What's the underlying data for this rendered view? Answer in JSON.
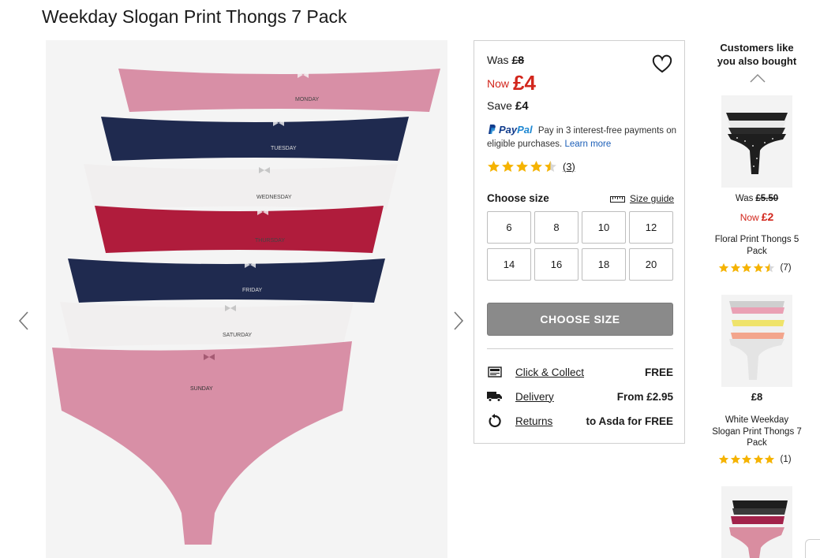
{
  "product": {
    "title": "Weekday Slogan Print Thongs 7 Pack"
  },
  "gallery": {
    "prev_icon": "chevron-left-icon",
    "next_icon": "chevron-right-icon",
    "image_colors": [
      "#d88fa6",
      "#1f2a4f",
      "#f1efef",
      "#b01c3c",
      "#1f2a4f",
      "#f1efef",
      "#d88fa6"
    ],
    "image_labels": [
      "MONDAY",
      "TUESDAY",
      "WEDNESDAY",
      "THURSDAY",
      "FRIDAY",
      "SATURDAY",
      "SUNDAY"
    ]
  },
  "pricing": {
    "was_label": "Was",
    "was_value": "£8",
    "now_label": "Now",
    "now_value": "£4",
    "save_label": "Save",
    "save_value": "£4",
    "accent": "#d2261c"
  },
  "paypal": {
    "logo_pay": "Pay",
    "logo_pal": "Pal",
    "text": "Pay in 3 interest-free payments on eligible purchases.",
    "link": "Learn more"
  },
  "rating": {
    "stars": 4.5,
    "count": "(3)",
    "star_color": "#f5b301"
  },
  "size": {
    "label": "Choose size",
    "guide": "Size guide",
    "options": [
      "6",
      "8",
      "10",
      "12",
      "14",
      "16",
      "18",
      "20"
    ],
    "button": "CHOOSE SIZE"
  },
  "delivery": [
    {
      "icon": "click-collect-icon",
      "label": "Click & Collect",
      "value": "FREE"
    },
    {
      "icon": "delivery-truck-icon",
      "label": "Delivery",
      "value": "From £2.95"
    },
    {
      "icon": "returns-icon",
      "label": "Returns",
      "value": "to Asda for FREE"
    }
  ],
  "recommendations": {
    "heading": "Customers like you also bought",
    "items": [
      {
        "was_label": "Was",
        "was": "£5.50",
        "now_label": "Now",
        "now": "£2",
        "name": "Floral Print Thongs 5 Pack",
        "stars": 4.5,
        "count": "(7)"
      },
      {
        "price": "£8",
        "name": "White Weekday Slogan Print Thongs 7 Pack",
        "stars": 5,
        "count": "(1)"
      },
      {
        "name": "",
        "stars": 0
      }
    ]
  }
}
